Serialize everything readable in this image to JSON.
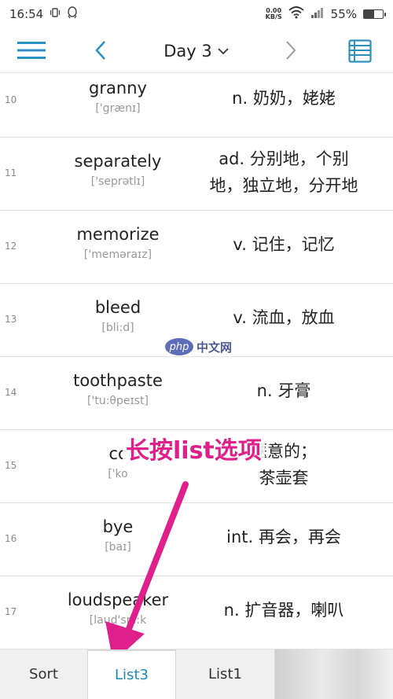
{
  "status_bar": {
    "time": "16:54",
    "net_speed_value": "0.00",
    "net_speed_unit": "KB/S",
    "battery_percent": "55%",
    "battery_level": 0.55
  },
  "toolbar": {
    "day_label": "Day 3",
    "accent_color": "#2a90c0"
  },
  "words": [
    {
      "num": "10",
      "word": "granny",
      "phonetic": "['grænɪ]",
      "meaning_lines": [
        "n. 奶奶，姥姥"
      ]
    },
    {
      "num": "11",
      "word": "separately",
      "phonetic": "['seprətlɪ]",
      "meaning_lines": [
        "ad. 分别地，个别",
        "地，独立地，分开地"
      ]
    },
    {
      "num": "12",
      "word": "memorize",
      "phonetic": "['meməraɪz]",
      "meaning_lines": [
        "v. 记住，记忆"
      ]
    },
    {
      "num": "13",
      "word": "bleed",
      "phonetic": "[bli:d]",
      "meaning_lines": [
        "v. 流血，放血"
      ]
    },
    {
      "num": "14",
      "word": "toothpaste",
      "phonetic": "['tu:θpeɪst]",
      "meaning_lines": [
        "n. 牙膏"
      ]
    },
    {
      "num": "15",
      "word": "cc",
      "phonetic": "['ko",
      "meaning_lines": [
        "惬意的；",
        "茶壶套"
      ]
    },
    {
      "num": "16",
      "word": "bye",
      "phonetic": "[baɪ]",
      "meaning_lines": [
        "int. 再会，再会"
      ]
    },
    {
      "num": "17",
      "word": "loudspeaker",
      "phonetic": "[laud'spi:k",
      "meaning_lines": [
        "n. 扩音器，喇叭"
      ]
    }
  ],
  "watermark": {
    "logo": "php",
    "text": "中文网"
  },
  "annotation": {
    "text": "长按list选项",
    "color": "#e0208a"
  },
  "tabs": [
    {
      "label": "Sort",
      "active": false
    },
    {
      "label": "List3",
      "active": true
    },
    {
      "label": "List1",
      "active": false
    }
  ]
}
